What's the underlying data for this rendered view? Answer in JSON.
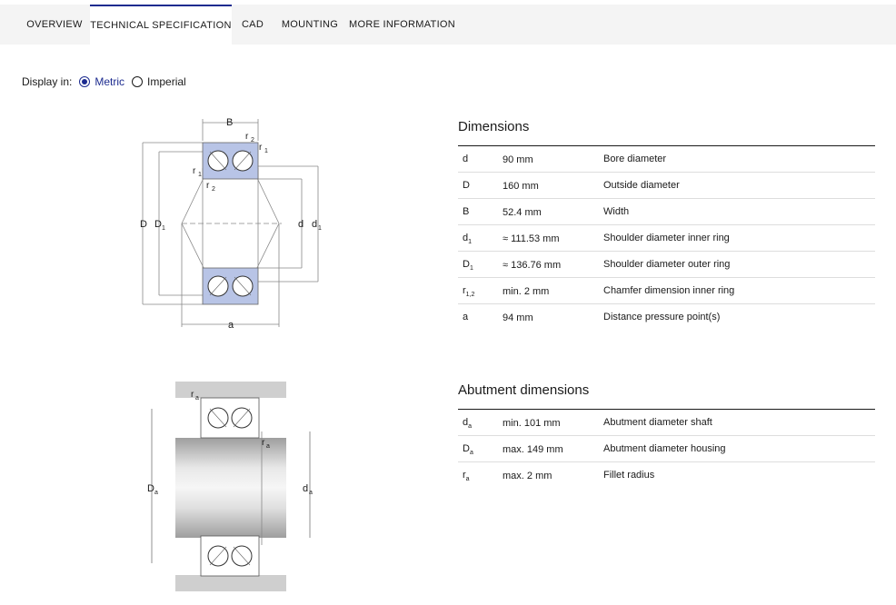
{
  "tabs": [
    {
      "label": "OVERVIEW"
    },
    {
      "label": "TECHNICAL SPECIFICATION"
    },
    {
      "label": "CAD"
    },
    {
      "label": "MOUNTING"
    },
    {
      "label": "MORE INFORMATION"
    }
  ],
  "active_tab": "TECHNICAL SPECIFICATION",
  "display": {
    "label": "Display in:",
    "metric": "Metric",
    "imperial": "Imperial",
    "selected": "Metric"
  },
  "dimensions": {
    "title": "Dimensions",
    "rows": [
      {
        "sym": "d",
        "sub": "",
        "val": "90 mm",
        "desc": "Bore diameter"
      },
      {
        "sym": "D",
        "sub": "",
        "val": "160 mm",
        "desc": "Outside diameter"
      },
      {
        "sym": "B",
        "sub": "",
        "val": "52.4 mm",
        "desc": "Width"
      },
      {
        "sym": "d",
        "sub": "1",
        "val": "≈ 111.53 mm",
        "desc": "Shoulder diameter inner ring"
      },
      {
        "sym": "D",
        "sub": "1",
        "val": "≈ 136.76 mm",
        "desc": "Shoulder diameter outer ring"
      },
      {
        "sym": "r",
        "sub": "1,2",
        "val": "min. 2 mm",
        "desc": "Chamfer dimension inner ring"
      },
      {
        "sym": "a",
        "sub": "",
        "val": "94 mm",
        "desc": "Distance pressure point(s)"
      }
    ]
  },
  "abutment": {
    "title": "Abutment dimensions",
    "rows": [
      {
        "sym": "d",
        "sub": "a",
        "val": "min. 101 mm",
        "desc": "Abutment diameter shaft"
      },
      {
        "sym": "D",
        "sub": "a",
        "val": "max. 149 mm",
        "desc": "Abutment diameter housing"
      },
      {
        "sym": "r",
        "sub": "a",
        "val": "max. 2 mm",
        "desc": "Fillet radius"
      }
    ]
  },
  "diagram1": {
    "labels": {
      "B": "B",
      "r": "r",
      "D": "D",
      "d": "d",
      "a": "a",
      "one": "1",
      "two": "2"
    }
  },
  "diagram2": {
    "labels": {
      "r": "r",
      "D": "D",
      "d": "d",
      "a": "a"
    }
  },
  "colors": {
    "accent": "#1c2b8f",
    "ring": "#b8c4e6",
    "shaft": "#cfcfcf"
  }
}
